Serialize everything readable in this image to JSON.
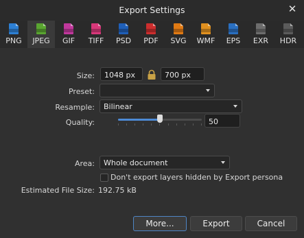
{
  "window": {
    "title": "Export Settings",
    "close_glyph": "✕"
  },
  "formats": [
    {
      "label": "PNG",
      "icon": "png-file-icon",
      "color": "#2d7fd3",
      "selected": false
    },
    {
      "label": "JPEG",
      "icon": "jpeg-file-icon",
      "color": "#5aa531",
      "selected": true
    },
    {
      "label": "GIF",
      "icon": "gif-file-icon",
      "color": "#c0389c",
      "selected": false
    },
    {
      "label": "TIFF",
      "icon": "tiff-file-icon",
      "color": "#d8387a",
      "selected": false
    },
    {
      "label": "PSD",
      "icon": "psd-file-icon",
      "color": "#1f5fb8",
      "selected": false
    },
    {
      "label": "PDF",
      "icon": "pdf-file-icon",
      "color": "#cc2e2e",
      "selected": false
    },
    {
      "label": "SVG",
      "icon": "svg-file-icon",
      "color": "#e07a14",
      "selected": false
    },
    {
      "label": "WMF",
      "icon": "wmf-file-icon",
      "color": "#e0901f",
      "selected": false
    },
    {
      "label": "EPS",
      "icon": "eps-file-icon",
      "color": "#2a6fc0",
      "selected": false
    },
    {
      "label": "EXR",
      "icon": "exr-file-icon",
      "color": "#6d6d6d",
      "selected": false
    },
    {
      "label": "HDR",
      "icon": "hdr-file-icon",
      "color": "#5b5b5b",
      "selected": false
    }
  ],
  "size": {
    "label": "Size:",
    "width_value": "1048 px",
    "height_value": "700 px",
    "lock_icon": "padlock-icon"
  },
  "preset": {
    "label": "Preset:",
    "value": ""
  },
  "resample": {
    "label": "Resample:",
    "value": "Bilinear"
  },
  "quality": {
    "label": "Quality:",
    "value": "50",
    "fraction": 0.5
  },
  "area": {
    "label": "Area:",
    "value": "Whole document"
  },
  "hidden_layers": {
    "label": "Don't export layers hidden by Export persona",
    "checked": false
  },
  "estimate": {
    "label": "Estimated File Size:",
    "value": "192.75 kB"
  },
  "buttons": {
    "more": "More...",
    "export": "Export",
    "cancel": "Cancel"
  },
  "colors": {
    "accent": "#4d8ad6",
    "lock": "#c9a246"
  }
}
